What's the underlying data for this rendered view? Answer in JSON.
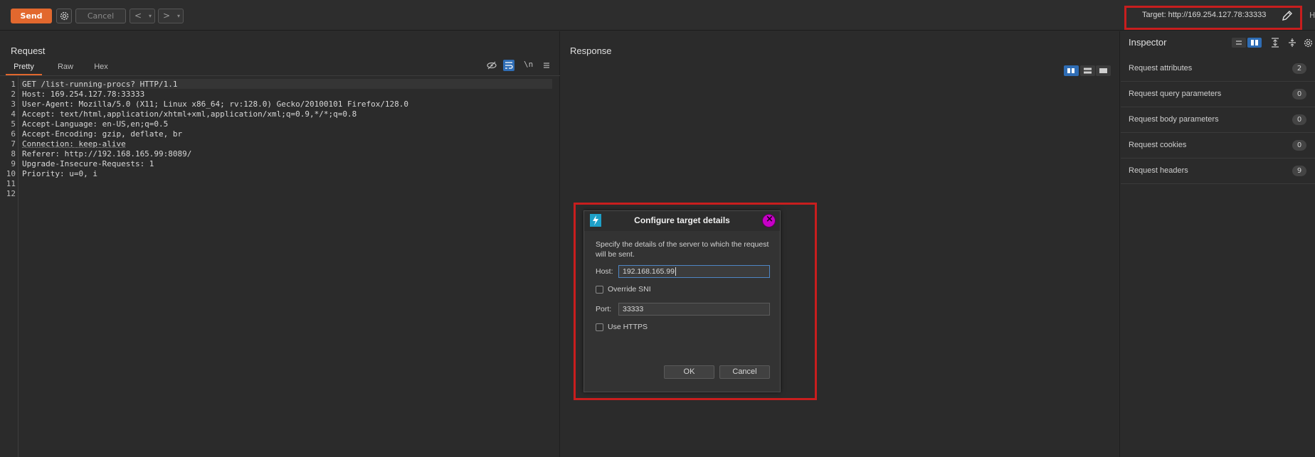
{
  "toolbar": {
    "send_label": "Send",
    "cancel_label": "Cancel",
    "back_glyph": "<",
    "forward_glyph": ">",
    "dropdown_glyph": "▾",
    "target_label": "Target: http://169.254.127.78:33333",
    "overflow_glyph": "H"
  },
  "request": {
    "title": "Request",
    "tabs": [
      {
        "label": "Pretty",
        "active": true
      },
      {
        "label": "Raw",
        "active": false
      },
      {
        "label": "Hex",
        "active": false
      }
    ],
    "newline_toggle": "\\n",
    "lines": [
      {
        "num": "1",
        "text": "GET /list-running-procs? HTTP/1.1"
      },
      {
        "num": "2",
        "text": "Host: 169.254.127.78:33333"
      },
      {
        "num": "3",
        "text": "User-Agent: Mozilla/5.0 (X11; Linux x86_64; rv:128.0) Gecko/20100101 Firefox/128.0"
      },
      {
        "num": "4",
        "text": "Accept: text/html,application/xhtml+xml,application/xml;q=0.9,*/*;q=0.8"
      },
      {
        "num": "5",
        "text": "Accept-Language: en-US,en;q=0.5"
      },
      {
        "num": "6",
        "text": "Accept-Encoding: gzip, deflate, br"
      },
      {
        "num": "7",
        "text": "Connection: keep-alive"
      },
      {
        "num": "8",
        "text": "Referer: http://192.168.165.99:8089/"
      },
      {
        "num": "9",
        "text": "Upgrade-Insecure-Requests: 1"
      },
      {
        "num": "10",
        "text": "Priority: u=0, i"
      },
      {
        "num": "11",
        "text": ""
      },
      {
        "num": "12",
        "text": ""
      }
    ]
  },
  "response": {
    "title": "Response"
  },
  "inspector": {
    "title": "Inspector",
    "rows": [
      {
        "label": "Request attributes",
        "count": "2"
      },
      {
        "label": "Request query parameters",
        "count": "0"
      },
      {
        "label": "Request body parameters",
        "count": "0"
      },
      {
        "label": "Request cookies",
        "count": "0"
      },
      {
        "label": "Request headers",
        "count": "9"
      }
    ]
  },
  "dialog": {
    "title": "Configure target details",
    "description": "Specify the details of the server to which the request will be sent.",
    "host_label": "Host:",
    "host_value": "192.168.165.99",
    "override_sni_label": "Override SNI",
    "port_label": "Port:",
    "port_value": "33333",
    "use_https_label": "Use HTTPS",
    "ok_label": "OK",
    "cancel_label": "Cancel",
    "close_glyph": "×"
  },
  "colors": {
    "accent": "#e2682e",
    "highlight_outline": "#c81e1e",
    "close_button": "#c800c8",
    "active_toggle": "#2f6db5"
  }
}
